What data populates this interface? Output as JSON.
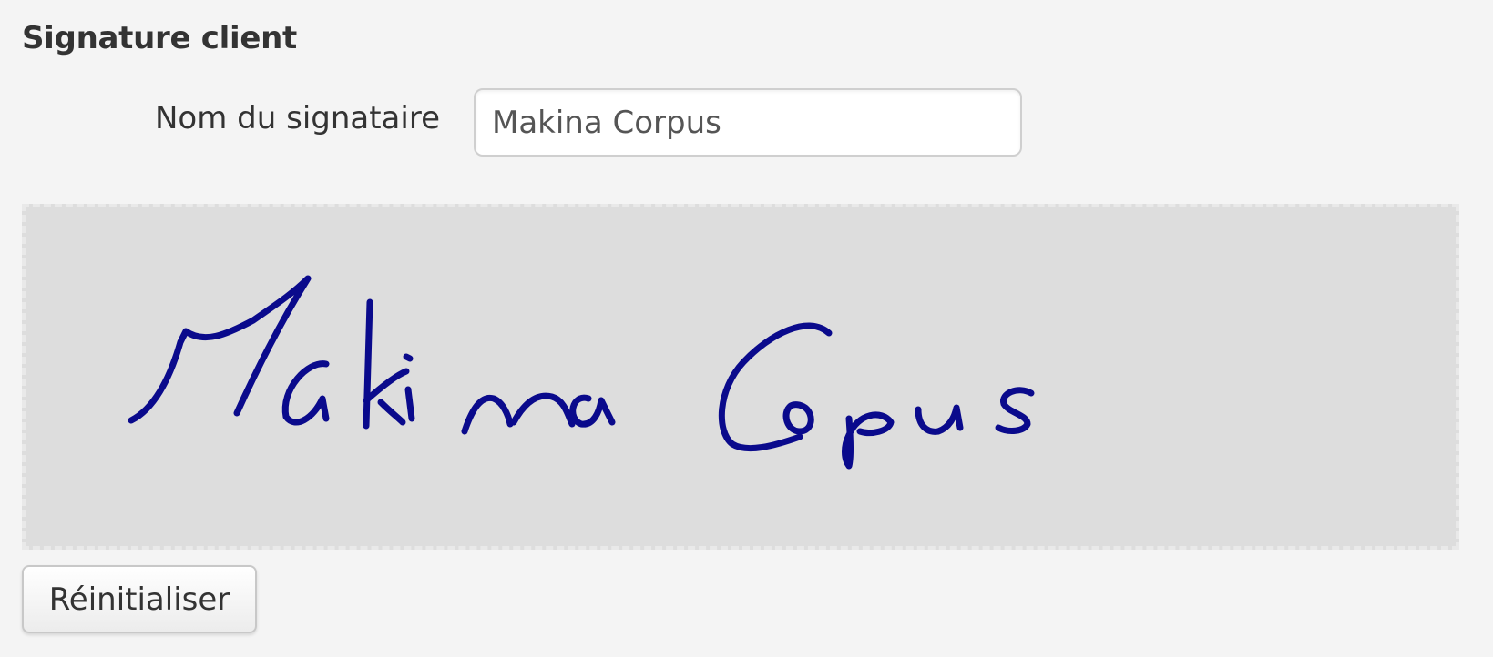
{
  "section": {
    "title": "Signature client"
  },
  "signer": {
    "label": "Nom du signataire",
    "value": "Makina Corpus"
  },
  "signature_pad": {
    "signed_text": "Makina Corpus",
    "ink_color": "#0a0a8c",
    "background_color": "#dddddd"
  },
  "actions": {
    "reset_label": "Réinitialiser"
  }
}
